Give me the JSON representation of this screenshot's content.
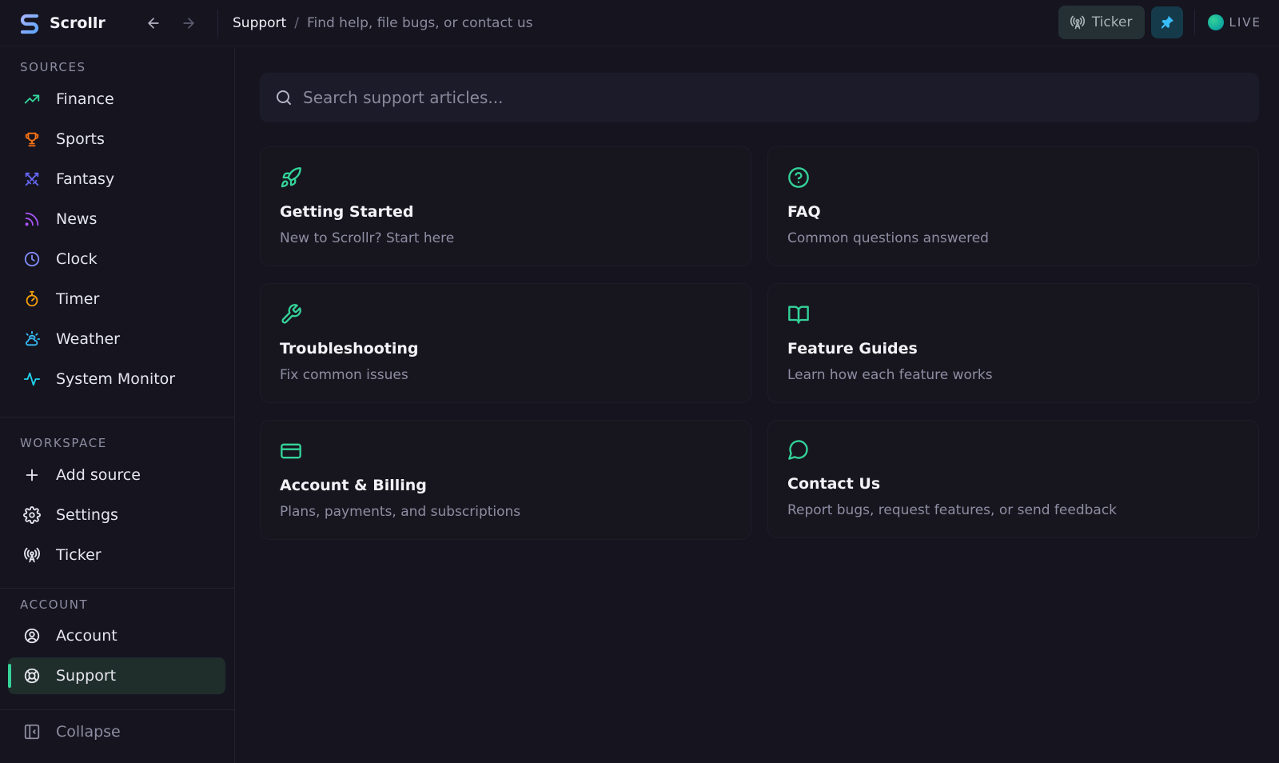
{
  "app": {
    "name": "Scrollr"
  },
  "breadcrumb": {
    "current": "Support",
    "separator": "/",
    "description": "Find help, file bugs, or contact us"
  },
  "topbar": {
    "ticker_label": "Ticker",
    "live_label": "LIVE"
  },
  "sidebar": {
    "sources_label": "SOURCES",
    "sources": [
      {
        "label": "Finance",
        "icon": "trending-up-icon",
        "color": "#34d399"
      },
      {
        "label": "Sports",
        "icon": "trophy-icon",
        "color": "#f97316"
      },
      {
        "label": "Fantasy",
        "icon": "swords-icon",
        "color": "#6366f1"
      },
      {
        "label": "News",
        "icon": "rss-icon",
        "color": "#a855f7"
      },
      {
        "label": "Clock",
        "icon": "clock-icon",
        "color": "#818cf8"
      },
      {
        "label": "Timer",
        "icon": "timer-icon",
        "color": "#f59e0b"
      },
      {
        "label": "Weather",
        "icon": "cloud-sun-icon",
        "color": "#38bdf8"
      },
      {
        "label": "System Monitor",
        "icon": "activity-icon",
        "color": "#22d3ee"
      }
    ],
    "workspace_label": "WORKSPACE",
    "workspace": [
      {
        "label": "Add source",
        "icon": "plus-icon"
      },
      {
        "label": "Settings",
        "icon": "gear-icon"
      },
      {
        "label": "Ticker",
        "icon": "broadcast-icon"
      }
    ],
    "account_label": "ACCOUNT",
    "account": [
      {
        "label": "Account",
        "icon": "user-circle-icon"
      },
      {
        "label": "Support",
        "icon": "life-buoy-icon",
        "active": true
      }
    ],
    "collapse_label": "Collapse"
  },
  "search": {
    "placeholder": "Search support articles..."
  },
  "cards": [
    {
      "title": "Getting Started",
      "description": "New to Scrollr? Start here",
      "icon": "rocket-icon"
    },
    {
      "title": "FAQ",
      "description": "Common questions answered",
      "icon": "help-circle-icon"
    },
    {
      "title": "Troubleshooting",
      "description": "Fix common issues",
      "icon": "wrench-icon"
    },
    {
      "title": "Feature Guides",
      "description": "Learn how each feature works",
      "icon": "book-open-icon"
    },
    {
      "title": "Account & Billing",
      "description": "Plans, payments, and subscriptions",
      "icon": "credit-card-icon"
    },
    {
      "title": "Contact Us",
      "description": "Report bugs, request features, or send feedback",
      "icon": "message-circle-icon"
    }
  ],
  "colors": {
    "accent": "#34d399",
    "background": "#15141f",
    "card": "#17161f",
    "active_item": "#1f2d2b"
  }
}
